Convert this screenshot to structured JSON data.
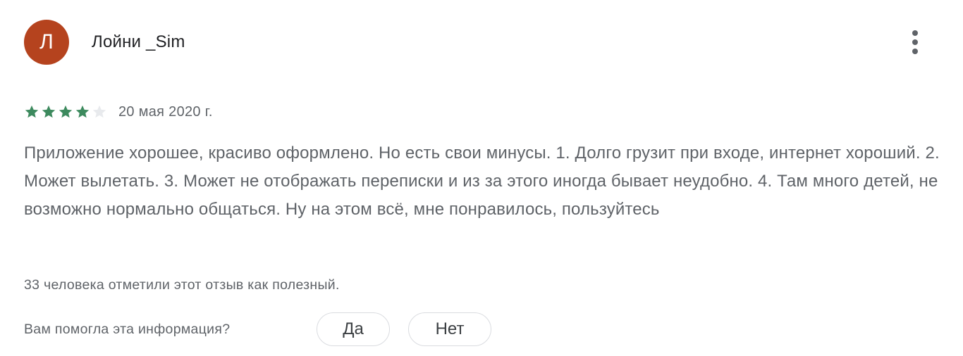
{
  "review": {
    "avatar_letter": "Л",
    "avatar_color": "#b5431e",
    "author": "Лойни _Sim",
    "menu_icon": "more-vert-icon",
    "rating": 4,
    "rating_max": 5,
    "star_filled_color": "#3d8a5e",
    "star_empty_color": "#e8eaed",
    "date": "20 мая 2020 г.",
    "text": "Приложение хорошее, красиво оформлено. Но есть свои минусы. 1. Долго грузит при входе, интернет хороший. 2. Может вылетать. 3. Может не отображать переписки и из за этого иногда бывает неудобно. 4. Там много детей, не возможно нормально общаться. Ну на этом всё, мне понравилось, пользуйтесь",
    "helpful_count": "33 человека отметили этот отзыв как полезный.",
    "helpful_question": "Вам помогла эта информация?",
    "yes_label": "Да",
    "no_label": "Нет"
  }
}
